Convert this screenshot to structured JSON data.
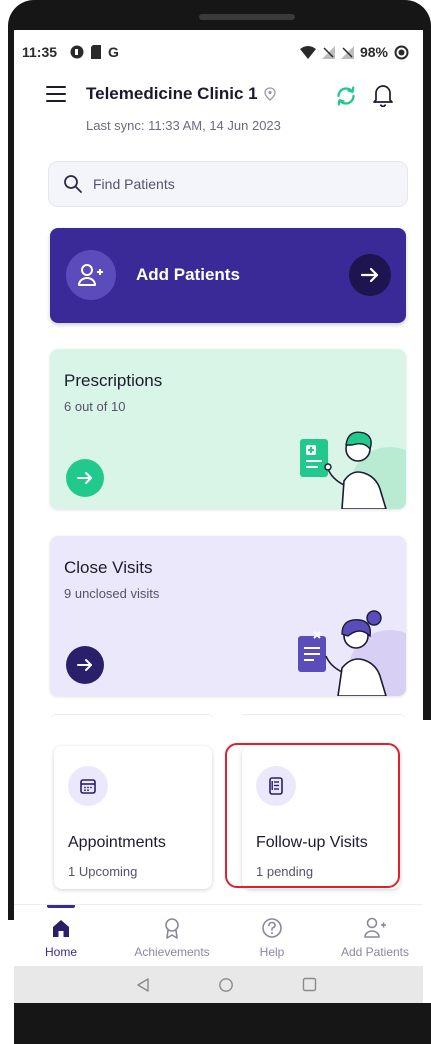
{
  "status_bar": {
    "time": "11:35",
    "carrier": "G",
    "battery": "98%"
  },
  "header": {
    "clinic_name": "Telemedicine Clinic 1",
    "last_sync": "Last sync: 11:33 AM, 14 Jun 2023"
  },
  "search": {
    "placeholder": "Find Patients"
  },
  "add_patients_card": {
    "label": "Add Patients"
  },
  "prescriptions_card": {
    "title": "Prescriptions",
    "subtitle": "6 out of 10"
  },
  "close_visits_card": {
    "title": "Close Visits",
    "subtitle": "9 unclosed visits"
  },
  "appointments_card": {
    "title": "Appointments",
    "subtitle": "1 Upcoming"
  },
  "followup_card": {
    "title": "Follow-up Visits",
    "subtitle": "1 pending"
  },
  "bottom_nav": {
    "items": [
      {
        "label": "Home",
        "icon": "home-icon",
        "active": true
      },
      {
        "label": "Achievements",
        "icon": "award-icon",
        "active": false
      },
      {
        "label": "Help",
        "icon": "help-icon",
        "active": false
      },
      {
        "label": "Add Patients",
        "icon": "add-user-icon",
        "active": false
      }
    ]
  },
  "colors": {
    "primary": "#3a2a98",
    "prescriptions_bg": "#d9f5e7",
    "prescriptions_accent": "#22c98d",
    "close_visits_bg": "#ece8fb",
    "highlight": "#e0202a"
  }
}
